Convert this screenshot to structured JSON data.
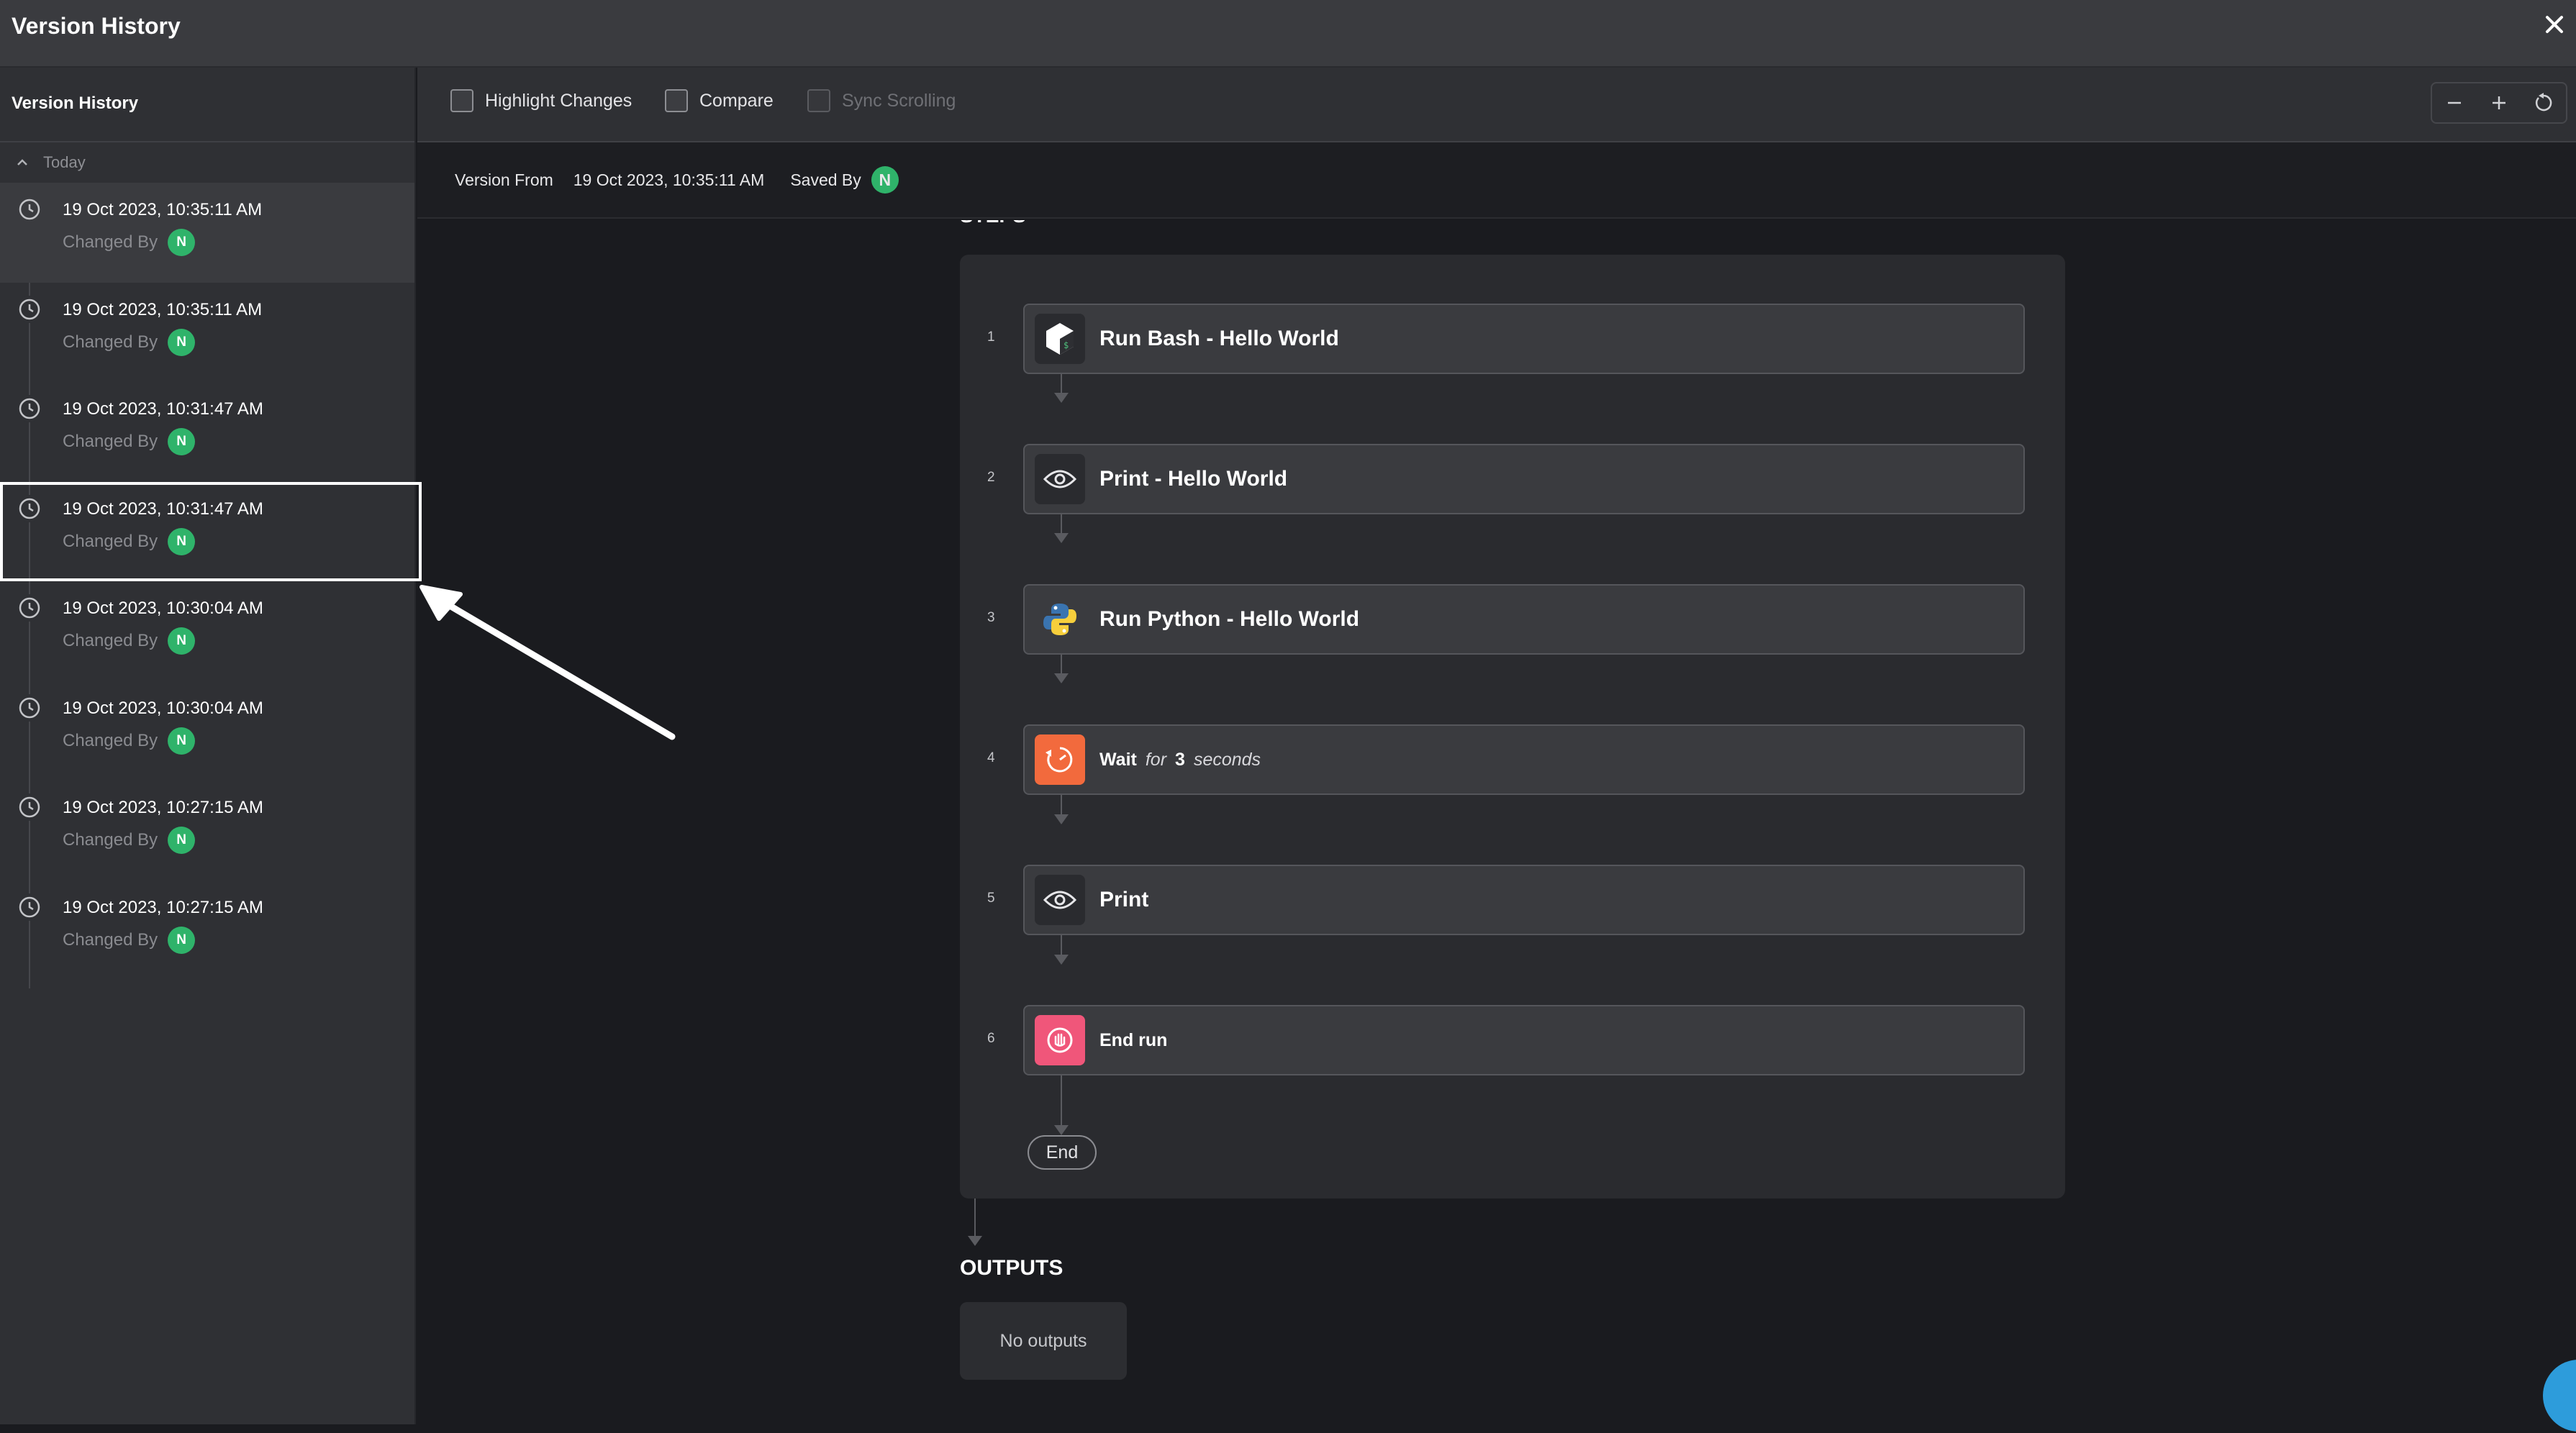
{
  "window": {
    "title": "Version History",
    "close_icon": "close-icon"
  },
  "sidebar": {
    "heading": "Version History",
    "group_label": "Today",
    "changed_by_label": "Changed By",
    "versions": [
      {
        "timestamp": "19 Oct 2023, 10:35:11 AM",
        "avatar": "N"
      },
      {
        "timestamp": "19 Oct 2023, 10:35:11 AM",
        "avatar": "N"
      },
      {
        "timestamp": "19 Oct 2023, 10:31:47 AM",
        "avatar": "N"
      },
      {
        "timestamp": "19 Oct 2023, 10:31:47 AM",
        "avatar": "N"
      },
      {
        "timestamp": "19 Oct 2023, 10:30:04 AM",
        "avatar": "N"
      },
      {
        "timestamp": "19 Oct 2023, 10:30:04 AM",
        "avatar": "N"
      },
      {
        "timestamp": "19 Oct 2023, 10:27:15 AM",
        "avatar": "N"
      },
      {
        "timestamp": "19 Oct 2023, 10:27:15 AM",
        "avatar": "N"
      }
    ]
  },
  "toolbar": {
    "highlight_changes": "Highlight Changes",
    "compare": "Compare",
    "sync_scrolling": "Sync Scrolling"
  },
  "infobar": {
    "version_from_label": "Version From",
    "version_from_value": "19 Oct 2023, 10:35:11 AM",
    "saved_by_label": "Saved By",
    "saved_by_avatar": "N"
  },
  "workflow": {
    "steps_label": "STEPS",
    "steps": [
      {
        "number": "1",
        "name": "Run Bash - Hello World",
        "icon": "bash-icon"
      },
      {
        "number": "2",
        "name": "Print - Hello World",
        "icon": "eye-icon"
      },
      {
        "number": "3",
        "name": "Run Python - Hello World",
        "icon": "python-icon"
      },
      {
        "number": "4",
        "name": "Wait",
        "wait_for": "for",
        "wait_value": "3",
        "wait_unit": "seconds",
        "icon": "timer-icon"
      },
      {
        "number": "5",
        "name": "Print",
        "icon": "eye-icon"
      },
      {
        "number": "6",
        "name": "End run",
        "icon": "hand-stop-icon"
      }
    ],
    "end_label": "End",
    "outputs_label": "OUTPUTS",
    "no_outputs": "No outputs"
  },
  "colors": {
    "avatar_green": "#2fb36a",
    "wait_orange": "#f26a3d",
    "end_pink": "#f0567a",
    "chat_blue": "#2d9cdb"
  }
}
